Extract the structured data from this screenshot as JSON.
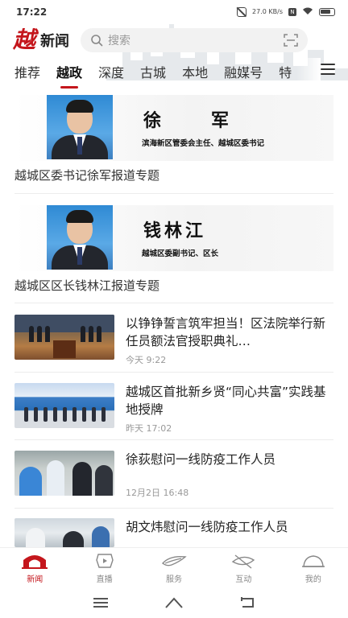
{
  "status_bar": {
    "time": "17:22",
    "net_speed_value": "27.0",
    "net_speed_unit": "KB/s",
    "badge": "N"
  },
  "header": {
    "logo_mark": "越",
    "logo_text": "新闻",
    "search_placeholder": "搜索"
  },
  "tabs": [
    {
      "label": "推荐",
      "active": false
    },
    {
      "label": "越政",
      "active": true
    },
    {
      "label": "深度",
      "active": false
    },
    {
      "label": "古城",
      "active": false
    },
    {
      "label": "本地",
      "active": false
    },
    {
      "label": "融媒号",
      "active": false
    },
    {
      "label": "特",
      "active": false
    }
  ],
  "features": [
    {
      "name": "徐　军",
      "role": "滨海新区管委会主任、越城区委书记",
      "title": "越城区委书记徐军报道专题"
    },
    {
      "name": "钱林江",
      "role": "越城区委副书记、区长",
      "title": "越城区区长钱林江报道专题"
    }
  ],
  "news": [
    {
      "title": "以铮铮誓言筑牢担当！区法院举行新任员额法官授职典礼…",
      "time": "今天  9:22"
    },
    {
      "title": "越城区首批新乡贤“同心共富”实践基地授牌",
      "time": "昨天  17:02"
    },
    {
      "title": "徐荻慰问一线防疫工作人员",
      "time": "12月2日  16:48"
    },
    {
      "title": "胡文炜慰问一线防疫工作人员",
      "time": ""
    }
  ],
  "bottom_nav": [
    {
      "label": "新闻",
      "icon": "news-icon",
      "active": true
    },
    {
      "label": "直播",
      "icon": "live-icon",
      "active": false
    },
    {
      "label": "服务",
      "icon": "service-icon",
      "active": false
    },
    {
      "label": "互动",
      "icon": "interact-icon",
      "active": false
    },
    {
      "label": "我的",
      "icon": "profile-icon",
      "active": false
    }
  ],
  "colors": {
    "accent": "#c4161c",
    "muted_text": "#999999"
  }
}
